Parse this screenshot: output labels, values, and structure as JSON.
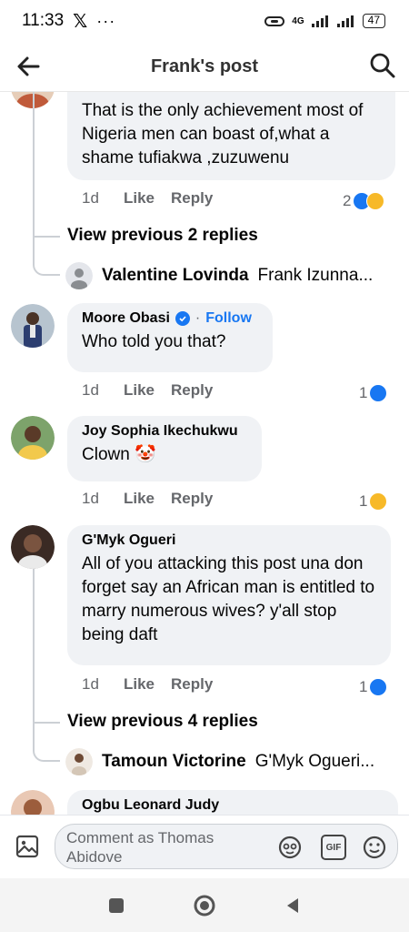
{
  "status_bar": {
    "time": "11:33",
    "app_x": "𝕏",
    "dots": "···",
    "network": "4G",
    "battery": "47"
  },
  "header": {
    "title": "Frank's post"
  },
  "comments": [
    {
      "text": "That is the only achievement most of Nigeria men can boast of,what a shame tufiakwa ,zuzuwenu",
      "time": "1d",
      "like_label": "Like",
      "reply_label": "Reply",
      "reaction_count": "2",
      "reactions": [
        "like-icon",
        "haha-icon"
      ]
    },
    {
      "author": "Moore Obasi",
      "separator": "·",
      "follow_label": "Follow",
      "text": "Who told you that?",
      "time": "1d",
      "like_label": "Like",
      "reply_label": "Reply",
      "reaction_count": "1",
      "reactions": [
        "like-icon"
      ]
    },
    {
      "author": "Joy Sophia Ikechukwu",
      "text": "Clown 🤡",
      "time": "1d",
      "like_label": "Like",
      "reply_label": "Reply",
      "reaction_count": "1",
      "reactions": [
        "haha-icon"
      ]
    },
    {
      "author": "G'Myk Ogueri",
      "text": "All of you attacking this post una don forget say an African man is entitled to marry numerous wives? y'all stop being daft",
      "time": "1d",
      "like_label": "Like",
      "reply_label": "Reply",
      "reaction_count": "1",
      "reactions": [
        "like-icon"
      ]
    },
    {
      "author": "Ogbu Leonard Judy"
    }
  ],
  "threads": [
    {
      "view_more": "View previous 2 replies",
      "preview_name": "Valentine Lovinda",
      "preview_snippet": "Frank Izunna..."
    },
    {
      "view_more": "View previous 4 replies",
      "preview_name": "Tamoun Victorine",
      "preview_snippet": "G'Myk Ogueri..."
    }
  ],
  "composer": {
    "placeholder": "Comment as Thomas Abidove",
    "gif_label": "GIF"
  },
  "colors": {
    "accent": "#1877f2",
    "bubble": "#f0f2f5",
    "muted_text": "#65676b"
  }
}
